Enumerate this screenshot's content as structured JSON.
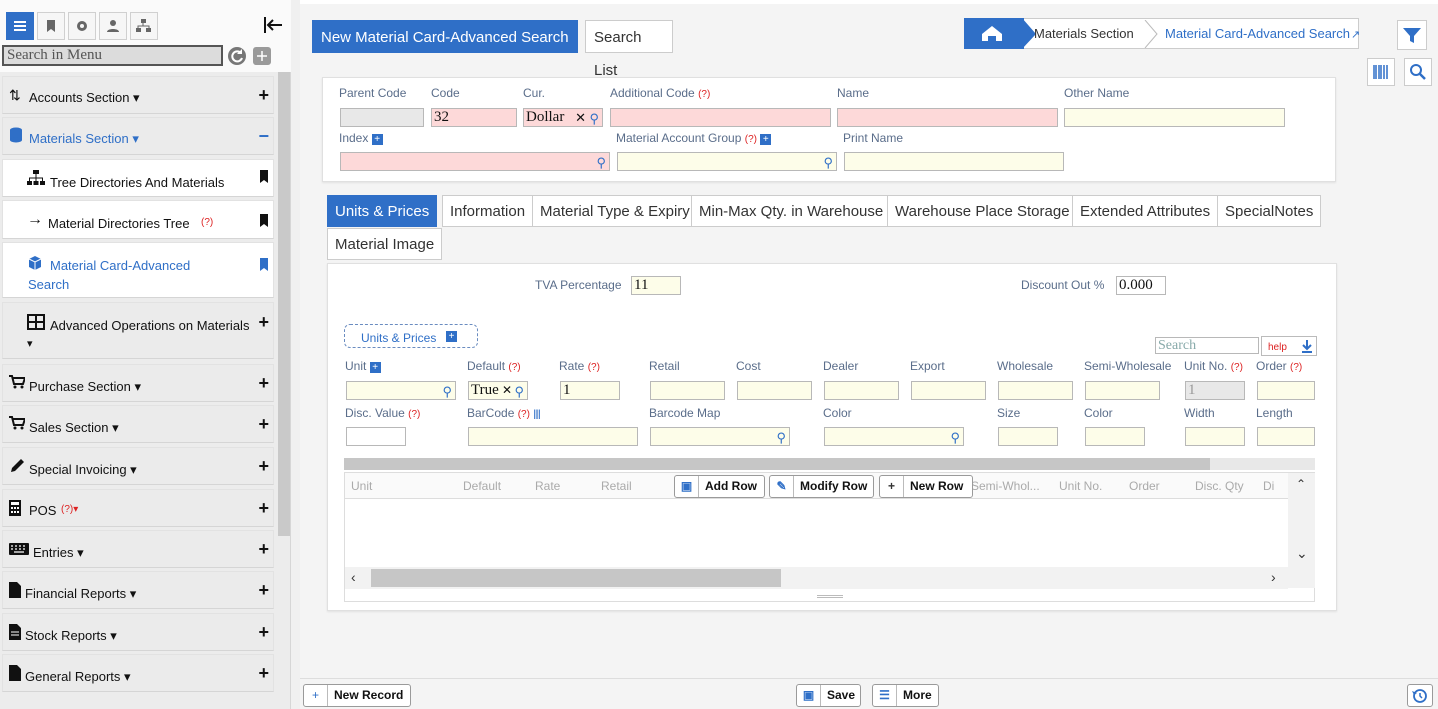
{
  "sidebar": {
    "search_placeholder": "Search in Menu",
    "items": [
      {
        "label": "Accounts Section ▾",
        "icon": "sort-icon"
      },
      {
        "label": "Materials Section ▾",
        "icon": "database-icon"
      },
      {
        "label": "Tree Directories And Materials",
        "icon": "sitemap-icon"
      },
      {
        "label": "Material Directories Tree",
        "help": "(?)",
        "icon": "arrow-right-icon"
      },
      {
        "label": "Material Card-Advanced",
        "label2": "Search",
        "icon": "cube-icon"
      },
      {
        "label": "Advanced Operations on Materials",
        "icon": "table-icon"
      },
      {
        "label": "Purchase Section ▾",
        "icon": "cart-icon"
      },
      {
        "label": "Sales Section ▾",
        "icon": "cart-icon"
      },
      {
        "label": "Special Invoicing ▾",
        "icon": "pencil-icon"
      },
      {
        "label": "POS",
        "help": "(?)▾",
        "icon": "calculator-icon"
      },
      {
        "label": "Entries ▾",
        "icon": "keyboard-icon"
      },
      {
        "label": "Financial Reports ▾",
        "icon": "file-icon"
      },
      {
        "label": "Stock Reports ▾",
        "icon": "file-text-icon"
      },
      {
        "label": "General Reports ▾",
        "icon": "file-icon"
      }
    ]
  },
  "tabs": {
    "active": "New Material Card-Advanced Search",
    "other": "Search List"
  },
  "breadcrumb": {
    "section": "Materials Section",
    "current": "Material Card-Advanced Search"
  },
  "header_form": {
    "parent_code": "Parent Code",
    "code": "Code",
    "code_value": "32",
    "cur": "Cur.",
    "cur_value": "Dollar",
    "additional_code": "Additional Code",
    "name": "Name",
    "other_name": "Other Name",
    "index": "Index",
    "material_account_group": "Material Account Group",
    "print_name": "Print Name",
    "help": "(?)"
  },
  "detail_tabs": [
    "Units & Prices",
    "Information",
    "Material Type & Expiry",
    "Min-Max Qty. in Warehouse",
    "Warehouse Place Storage",
    "Extended Attributes",
    "SpecialNotes",
    "Material Image"
  ],
  "units": {
    "tva_label": "TVA Percentage",
    "tva_value": "11",
    "discount_label": "Discount Out %",
    "discount_value": "0.000",
    "section_label": "Units & Prices",
    "search_placeholder": "Search",
    "help": "help",
    "row1": [
      "Unit",
      "Default",
      "Rate",
      "Retail",
      "Cost",
      "Dealer",
      "Export",
      "Wholesale",
      "Semi-Wholesale",
      "Unit No.",
      "Order"
    ],
    "default_value": "True",
    "rate_value": "1",
    "unit_no_value": "1",
    "row2": [
      "Disc. Value",
      "BarCode",
      "Barcode Map",
      "Color",
      "Size",
      "Color",
      "Width",
      "Length"
    ],
    "grid_cols": [
      "Unit",
      "Default",
      "Rate",
      "Retail",
      "Semi-Whol...",
      "Unit No.",
      "Order",
      "Disc. Qty",
      "Di"
    ],
    "add_row": "Add Row",
    "modify_row": "Modify Row",
    "new_row": "New Row"
  },
  "footer": {
    "new_record": "New Record",
    "save": "Save",
    "more": "More"
  }
}
